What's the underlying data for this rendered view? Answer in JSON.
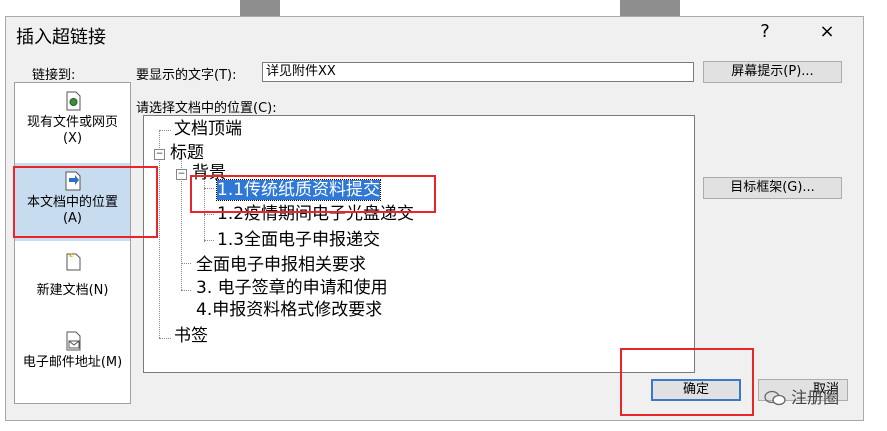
{
  "dialog": {
    "title": "插入超链接",
    "help_label": "?",
    "close_label": "×"
  },
  "link_to": {
    "label": "链接到:",
    "items": [
      {
        "label": "现有文件或网页(X)"
      },
      {
        "label": "本文档中的位置(A)"
      },
      {
        "label": "新建文档(N)"
      },
      {
        "label": "电子邮件地址(M)"
      }
    ],
    "selected_index": 1
  },
  "display_text": {
    "label": "要显示的文字(T):",
    "value": "详见附件XX"
  },
  "screentip_button": "屏幕提示(P)...",
  "location": {
    "label": "请选择文档中的位置(C):",
    "tree": [
      "文档顶端",
      "标题",
      "背景",
      "1.1传统纸质资料提交",
      "1.2疫情期间电子光盘递交",
      "1.3全面电子申报递交",
      "全面电子申报相关要求",
      "3.  电子签章的申请和使用",
      "4.申报资料格式修改要求",
      "书签"
    ]
  },
  "target_frame_button": "目标框架(G)...",
  "ok_button": "确定",
  "cancel_button": "取消",
  "watermark": "注册圈"
}
